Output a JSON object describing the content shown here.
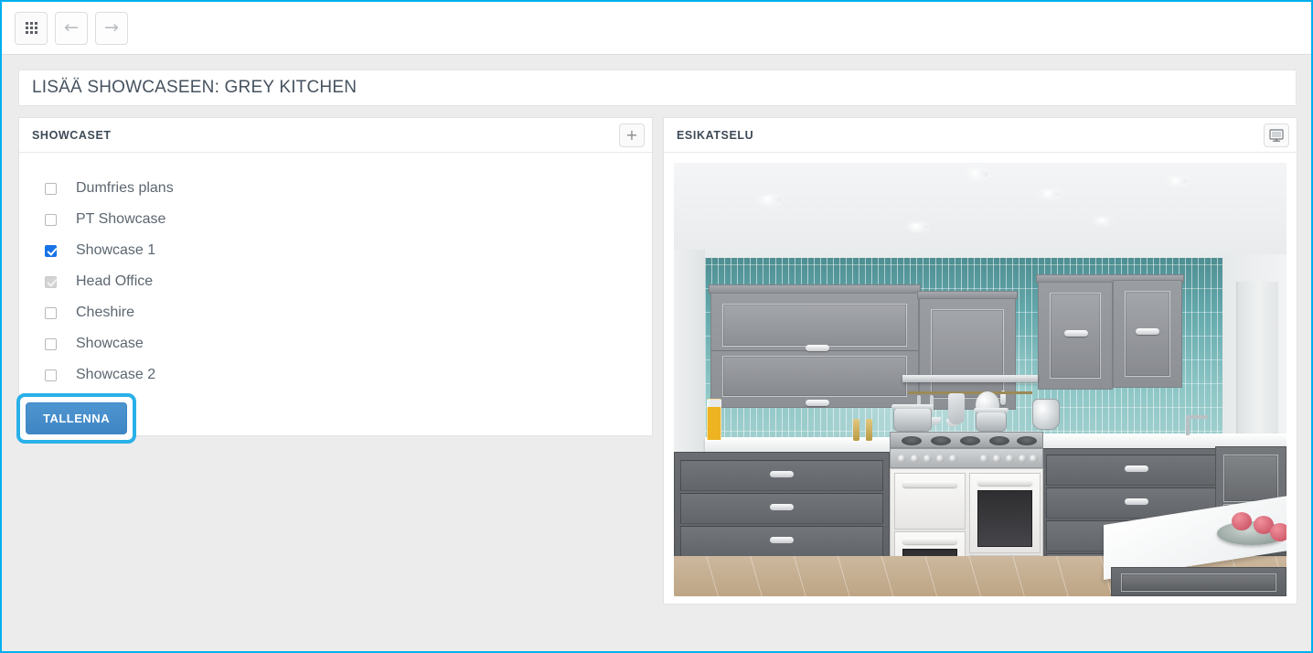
{
  "toolbar": {
    "grid_button": "grid-view",
    "back_button": "back",
    "forward_button": "forward",
    "back_glyph": "←",
    "forward_glyph": "→"
  },
  "page": {
    "title": "LISÄÄ SHOWCASEEN: GREY KITCHEN"
  },
  "left_panel": {
    "header": "SHOWCASET",
    "add_button_glyph": "+",
    "items": [
      {
        "label": "Dumfries plans",
        "checked": false,
        "disabled": false
      },
      {
        "label": "PT Showcase",
        "checked": false,
        "disabled": false
      },
      {
        "label": "Showcase 1",
        "checked": true,
        "disabled": false
      },
      {
        "label": "Head Office",
        "checked": true,
        "disabled": true
      },
      {
        "label": "Cheshire",
        "checked": false,
        "disabled": false
      },
      {
        "label": "Showcase",
        "checked": false,
        "disabled": false
      },
      {
        "label": "Showcase 2",
        "checked": false,
        "disabled": false
      }
    ],
    "save_label": "TALLENNA"
  },
  "right_panel": {
    "header": "ESIKATSELU",
    "display_button": "monitor-display",
    "preview_alt": "Grey kitchen 3D render"
  },
  "colors": {
    "focus_ring": "#2ab0e8",
    "viewport_border": "#00aeef",
    "accent_button": "#4e95d0",
    "checkbox_checked": "#1673e6",
    "title_text": "#46525f",
    "page_background": "#ececec"
  }
}
